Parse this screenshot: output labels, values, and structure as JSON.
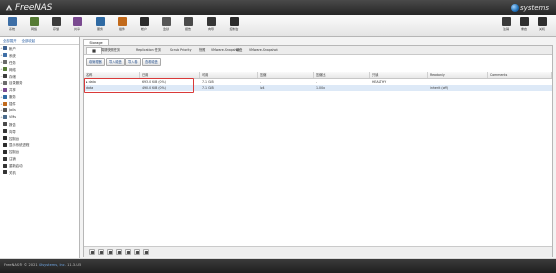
{
  "header": {
    "brand": "FreeNAS",
    "vendor": "systems"
  },
  "toolbar": {
    "left": [
      {
        "label": "系统",
        "icon": "system-icon",
        "color": "#3d6ea6"
      },
      {
        "label": "网络",
        "icon": "network-icon",
        "color": "#557a34"
      },
      {
        "label": "存储",
        "icon": "storage-icon",
        "color": "#3c3c3c"
      },
      {
        "label": "共享",
        "icon": "sharing-icon",
        "color": "#7a4a90"
      },
      {
        "label": "服务",
        "icon": "services-icon",
        "color": "#2f6aa3"
      },
      {
        "label": "插件",
        "icon": "plugins-icon",
        "color": "#c26a1b"
      },
      {
        "label": "帐户",
        "icon": "account-icon",
        "color": "#2c2c2c"
      },
      {
        "label": "监狱",
        "icon": "jails-icon",
        "color": "#555555"
      },
      {
        "label": "报告",
        "icon": "reporting-icon",
        "color": "#4a4a4a"
      },
      {
        "label": "向导",
        "icon": "wizard-icon",
        "color": "#363636"
      },
      {
        "label": "控制台",
        "icon": "shell-icon",
        "color": "#2b2b2b"
      }
    ],
    "right": [
      {
        "label": "注销",
        "icon": "logout-icon",
        "color": "#3a3a3a"
      },
      {
        "label": "重启",
        "icon": "reboot-icon",
        "color": "#2f2f2f"
      },
      {
        "label": "关机",
        "icon": "shutdown-icon",
        "color": "#2f2f2f"
      }
    ]
  },
  "tree": {
    "tabs": [
      "全部展开",
      "全部收起"
    ],
    "items": [
      {
        "label": "帐户",
        "expander": "+",
        "icon": "account-icon",
        "color": "#3b5f8f"
      },
      {
        "label": "系统",
        "expander": "+",
        "icon": "system-icon",
        "color": "#3d6ea6"
      },
      {
        "label": "任务",
        "expander": "+",
        "icon": "tasks-icon",
        "color": "#6a6a6a"
      },
      {
        "label": "网络",
        "expander": "+",
        "icon": "network-icon",
        "color": "#557a34"
      },
      {
        "label": "存储",
        "expander": "−",
        "icon": "storage-icon",
        "color": "#3c3c3c"
      },
      {
        "label": "目录服务",
        "expander": "+",
        "icon": "directory-icon",
        "color": "#6b6b6b"
      },
      {
        "label": "共享",
        "expander": "+",
        "icon": "sharing-icon",
        "color": "#7a4a90"
      },
      {
        "label": "服务",
        "expander": "+",
        "icon": "services-icon",
        "color": "#2f6aa3"
      },
      {
        "label": "插件",
        "expander": "+",
        "icon": "plugins-icon",
        "color": "#c26a1b"
      },
      {
        "label": "Jails",
        "expander": "+",
        "icon": "jails-icon",
        "color": "#555555"
      },
      {
        "label": "VMs",
        "expander": "+",
        "icon": "vm-icon",
        "color": "#4a6a8a"
      },
      {
        "label": "报告",
        "expander": "",
        "icon": "reporting-icon",
        "color": "#4a4a4a"
      },
      {
        "label": "向导",
        "expander": "",
        "icon": "wizard-icon",
        "color": "#363636"
      },
      {
        "label": "控制台",
        "expander": "",
        "icon": "shell-icon",
        "color": "#2b2b2b"
      },
      {
        "label": "显示系统进程",
        "expander": "",
        "icon": "process-icon",
        "color": "#2b2b2b"
      },
      {
        "label": "控制台",
        "expander": "",
        "icon": "console-icon",
        "color": "#2b2b2b"
      },
      {
        "label": "注销",
        "expander": "",
        "icon": "logout-icon",
        "color": "#333333"
      },
      {
        "label": "重新启动",
        "expander": "",
        "icon": "reboot-icon",
        "color": "#333333"
      },
      {
        "label": "关机",
        "expander": "",
        "icon": "shutdown-icon",
        "color": "#333333"
      }
    ]
  },
  "main": {
    "tab_title": "Storage",
    "subtabs": [
      "卷",
      "周期快照任务",
      "Replication 任务",
      "Scrub Priority",
      "快照",
      "VMware-Snapshot",
      "磁盘",
      "VMware-Snapshot"
    ],
    "actions": [
      "卷管理器",
      "导入磁盘",
      "导入卷",
      "查看磁盘"
    ],
    "columns": [
      "名称",
      "已用",
      "可用",
      "压缩",
      "压缩比",
      "只读",
      "Readonly",
      "Comments"
    ],
    "rows": [
      {
        "name": "▸ data",
        "used": "693.0 KiB (0%)",
        "avail": "7.1 GiB",
        "comp": "-",
        "ratio": "-",
        "ro": "HEALTHY",
        "readonly": "",
        "comments": ""
      },
      {
        "name": "   data",
        "used": "490.0 KiB (0%)",
        "avail": "7.1 GiB",
        "comp": "lz4",
        "ratio": "1.00x",
        "ro": "",
        "readonly": "inherit (off)",
        "comments": ""
      }
    ]
  },
  "footer": {
    "text": "FreeNAS® © 2021",
    "link": "iXsystems, Inc.",
    "build": "11.3-U5"
  }
}
